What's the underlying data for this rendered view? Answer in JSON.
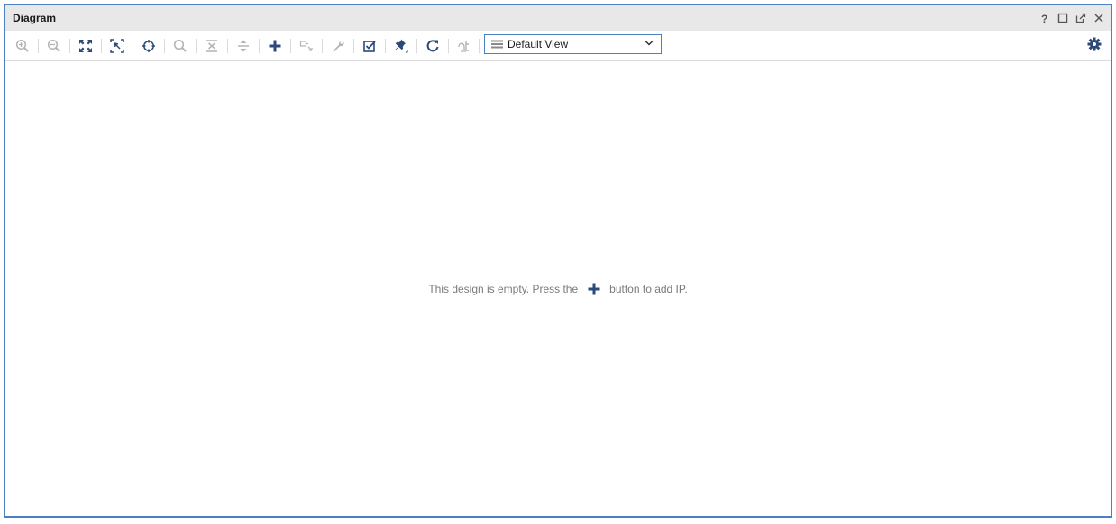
{
  "window": {
    "title": "Diagram",
    "controls": [
      "help-icon",
      "maximize-icon",
      "float-icon",
      "close-icon"
    ]
  },
  "toolbar": {
    "buttons": [
      {
        "icon": "zoom-in-icon",
        "enabled": false
      },
      {
        "icon": "zoom-out-icon",
        "enabled": false
      },
      {
        "icon": "zoom-fit-icon",
        "enabled": true
      },
      {
        "icon": "zoom-area-icon",
        "enabled": true
      },
      {
        "icon": "auto-fit-selection-icon",
        "enabled": true
      },
      {
        "icon": "search-icon",
        "enabled": false
      },
      {
        "icon": "collapse-all-icon",
        "enabled": false
      },
      {
        "icon": "expand-all-icon",
        "enabled": false
      },
      {
        "icon": "add-ip-icon",
        "enabled": true
      },
      {
        "icon": "make-external-icon",
        "enabled": false
      },
      {
        "icon": "wrench-icon",
        "enabled": false
      },
      {
        "icon": "validate-design-icon",
        "enabled": true
      },
      {
        "icon": "pin-icon",
        "enabled": true
      },
      {
        "icon": "regenerate-layout-icon",
        "enabled": true
      },
      {
        "icon": "optimize-routing-icon",
        "enabled": false
      }
    ],
    "view_select": {
      "value": "Default View"
    },
    "settings_icon": "gear-icon"
  },
  "canvas": {
    "empty_message_before": "This design is empty. Press the",
    "empty_message_after": "button to add IP."
  },
  "colors": {
    "accent": "#4d7fc4",
    "icon_active": "#2b4a78",
    "icon_disabled": "#b4b4b4",
    "titlebar": "#e8e8e8"
  }
}
